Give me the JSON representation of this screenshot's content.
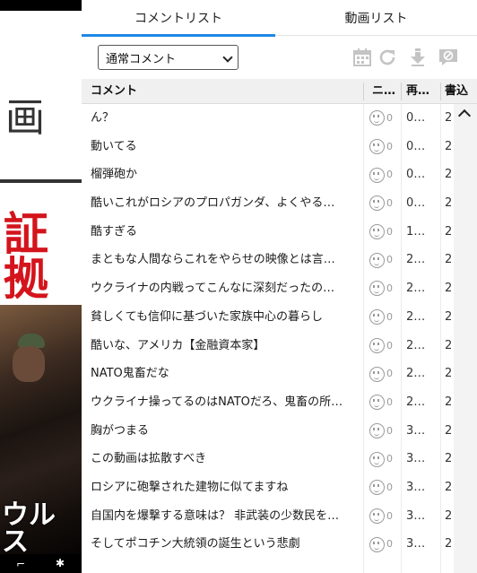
{
  "video": {
    "overlay_text_1": "画",
    "overlay_text_2": "証拠",
    "overlay_text_3": "ウルス"
  },
  "tabs": [
    {
      "label": "コメントリスト",
      "active": true
    },
    {
      "label": "動画リスト",
      "active": false
    }
  ],
  "toolbar": {
    "filter_select": {
      "selected": "通常コメント"
    },
    "icons": [
      "calendar-icon",
      "refresh-icon",
      "download-icon",
      "ng-comment-icon"
    ],
    "icon_color": "#c4c4c4"
  },
  "table": {
    "headers": {
      "comment": "コメント",
      "nicoru": "ニ…",
      "playback_time": "再…",
      "written_at": "書込"
    },
    "rows": [
      {
        "comment": "ん？",
        "nicoru": "0",
        "time": "0…",
        "date": "2"
      },
      {
        "comment": "動いてる",
        "nicoru": "0",
        "time": "0…",
        "date": "2"
      },
      {
        "comment": "榴弾砲か",
        "nicoru": "0",
        "time": "0…",
        "date": "2"
      },
      {
        "comment": "酷いこれがロシアのプロパガンダ、よくやる…",
        "nicoru": "0",
        "time": "0…",
        "date": "2"
      },
      {
        "comment": "酷すぎる",
        "nicoru": "0",
        "time": "1…",
        "date": "2"
      },
      {
        "comment": "まともな人間ならこれをやらせの映像とは言…",
        "nicoru": "0",
        "time": "2…",
        "date": "2"
      },
      {
        "comment": "ウクライナの内戦ってこんなに深刻だったの…",
        "nicoru": "0",
        "time": "2…",
        "date": "2"
      },
      {
        "comment": "貧しくても信仰に基づいた家族中心の暮らし",
        "nicoru": "0",
        "time": "2…",
        "date": "2"
      },
      {
        "comment": "酷いな、アメリカ【金融資本家】",
        "nicoru": "0",
        "time": "2…",
        "date": "2"
      },
      {
        "comment": "NATO鬼畜だな",
        "nicoru": "0",
        "time": "2…",
        "date": "2"
      },
      {
        "comment": "ウクライナ操ってるのはNATOだろ、鬼畜の所…",
        "nicoru": "0",
        "time": "2…",
        "date": "2"
      },
      {
        "comment": "胸がつまる",
        "nicoru": "0",
        "time": "3…",
        "date": "2"
      },
      {
        "comment": "この動画は拡散すべき",
        "nicoru": "0",
        "time": "3…",
        "date": "2"
      },
      {
        "comment": "ロシアに砲撃された建物に似てますね",
        "nicoru": "0",
        "time": "3…",
        "date": "2"
      },
      {
        "comment": "自国内を爆撃する意味は？ 非武装の少数民を…",
        "nicoru": "0",
        "time": "3…",
        "date": "2"
      },
      {
        "comment": "そしてポコチン大統領の誕生という悲劇",
        "nicoru": "0",
        "time": "3…",
        "date": "2"
      }
    ]
  },
  "colors": {
    "accent": "#1e88e5",
    "header_bg": "#f0f0f0",
    "red_caption": "#d4141c"
  }
}
